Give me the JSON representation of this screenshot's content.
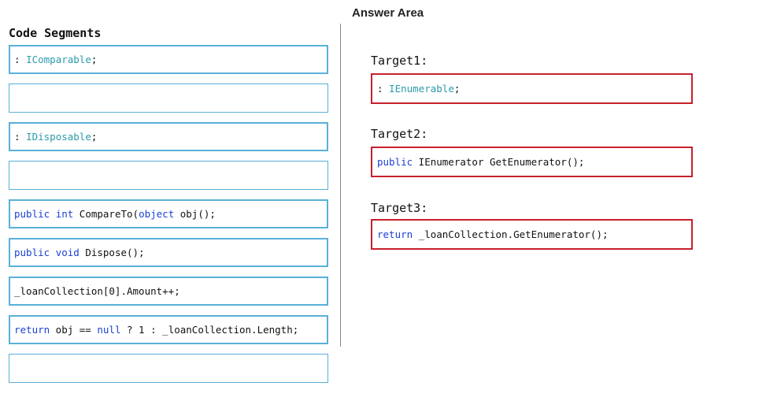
{
  "answer_area": {
    "title": "Answer Area"
  },
  "code_segments": {
    "title": "Code Segments",
    "items": [
      {
        "parts": [
          {
            "text": ": ",
            "kind": "plain"
          },
          {
            "text": "IComparable",
            "kind": "type"
          },
          {
            "text": ";",
            "kind": "plain"
          }
        ]
      },
      {
        "parts": []
      },
      {
        "parts": [
          {
            "text": ": ",
            "kind": "plain"
          },
          {
            "text": "IDisposable",
            "kind": "type"
          },
          {
            "text": ";",
            "kind": "plain"
          }
        ]
      },
      {
        "parts": []
      },
      {
        "parts": [
          {
            "text": "public",
            "kind": "keyword"
          },
          {
            "text": " ",
            "kind": "plain"
          },
          {
            "text": "int",
            "kind": "keyword"
          },
          {
            "text": " CompareTo(",
            "kind": "plain"
          },
          {
            "text": "object",
            "kind": "keyword"
          },
          {
            "text": " obj();",
            "kind": "plain"
          }
        ]
      },
      {
        "parts": [
          {
            "text": "public",
            "kind": "keyword"
          },
          {
            "text": " ",
            "kind": "plain"
          },
          {
            "text": "void",
            "kind": "keyword"
          },
          {
            "text": " Dispose();",
            "kind": "plain"
          }
        ]
      },
      {
        "parts": [
          {
            "text": "_loanCollection[0].Amount++;",
            "kind": "plain"
          }
        ]
      },
      {
        "parts": [
          {
            "text": "return",
            "kind": "keyword"
          },
          {
            "text": " obj == ",
            "kind": "plain"
          },
          {
            "text": "null",
            "kind": "keyword"
          },
          {
            "text": " ? 1 : _loanCollection.Length;",
            "kind": "plain"
          }
        ]
      },
      {
        "parts": []
      }
    ]
  },
  "targets": [
    {
      "label": "Target1:",
      "parts": [
        {
          "text": ": ",
          "kind": "plain"
        },
        {
          "text": "IEnumerable",
          "kind": "type"
        },
        {
          "text": ";",
          "kind": "plain"
        }
      ]
    },
    {
      "label": "Target2:",
      "parts": [
        {
          "text": "public",
          "kind": "keyword"
        },
        {
          "text": " IEnumerator GetEnumerator();",
          "kind": "plain"
        }
      ]
    },
    {
      "label": "Target3:",
      "parts": [
        {
          "text": "return",
          "kind": "keyword"
        },
        {
          "text": " _loanCollection.GetEnumerator();",
          "kind": "plain"
        }
      ]
    }
  ],
  "colors": {
    "segment_border": "#5ab0d8",
    "target_border": "#c8202c",
    "keyword": "#1a3fd6",
    "type": "#2a9bab"
  }
}
